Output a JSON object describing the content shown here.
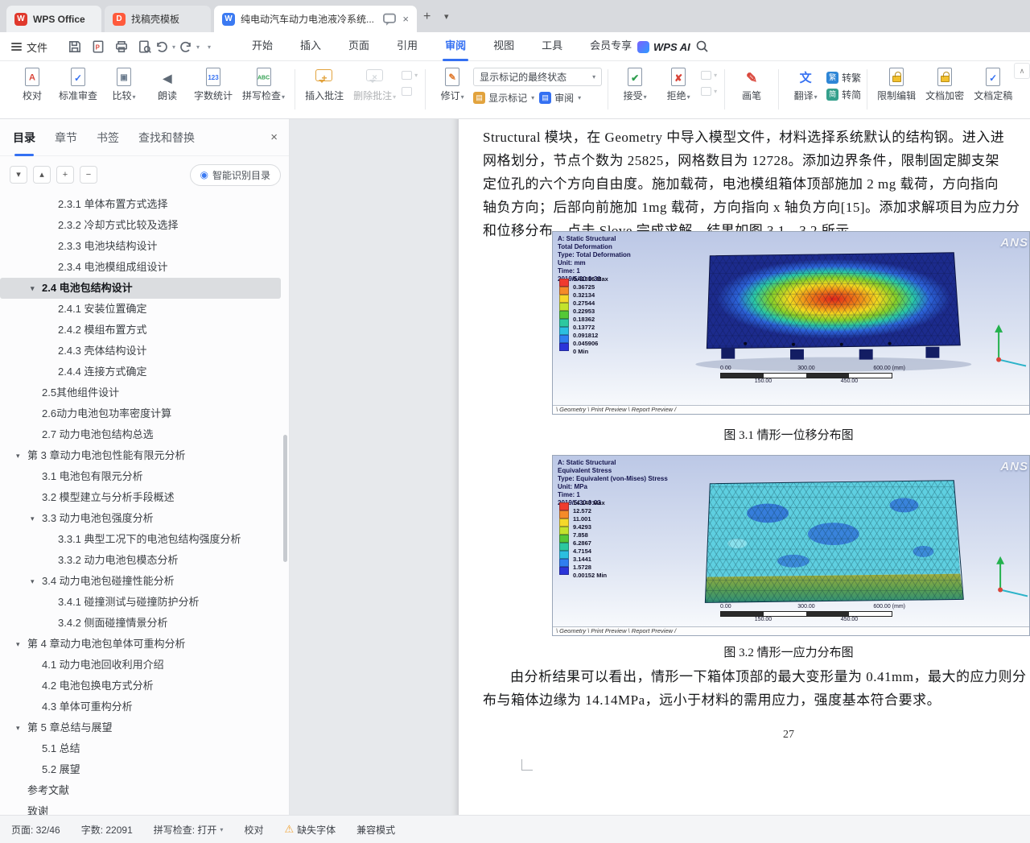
{
  "titlebar": {
    "home_tab": "WPS Office",
    "docer_tab": "找稿壳模板",
    "doc_tab": "纯电动汽车动力电池液冷系统..."
  },
  "menubar": {
    "file": "文件",
    "tabs": [
      "开始",
      "插入",
      "页面",
      "引用",
      "审阅",
      "视图",
      "工具",
      "会员专享"
    ],
    "active_tab_index": 4,
    "ai_label": "WPS AI"
  },
  "ribbon": {
    "markup_state": "显示标记的最终状态",
    "show_markup": "显示标记",
    "review": "审阅",
    "buttons": [
      {
        "g": 0,
        "name": "proofread",
        "icon": "proofread-icon",
        "label": "校对",
        "kind": "doc",
        "glyph": "A",
        "gc": "#d9453a",
        "gsize": "11px"
      },
      {
        "g": 0,
        "name": "standard-check",
        "icon": "standard-check-icon",
        "label": "标准审查",
        "kind": "doc",
        "glyph": "✓",
        "gc": "#3470f2",
        "gsize": "12px"
      },
      {
        "g": 0,
        "name": "compare",
        "icon": "compare-icon",
        "label": "比较",
        "kind": "doc",
        "glyph": "▣",
        "gc": "#6b7b8d",
        "gsize": "10px",
        "caret": true
      },
      {
        "g": 0,
        "name": "read-aloud",
        "icon": "read-aloud-icon",
        "label": "朗读",
        "kind": "plain",
        "glyph": "◀",
        "gc": "#5f6a76",
        "gsize": "14px"
      },
      {
        "g": 0,
        "name": "word-count",
        "icon": "word-count-icon",
        "label": "字数统计",
        "kind": "doc",
        "glyph": "123",
        "gc": "#3470f2",
        "gsize": "8px"
      },
      {
        "g": 0,
        "name": "spell-check",
        "icon": "spell-check-icon",
        "label": "拼写检查",
        "kind": "doc",
        "glyph": "ABC",
        "gc": "#2f9e4f",
        "gsize": "7px",
        "caret": true
      },
      {
        "g": 1,
        "name": "insert-comment",
        "icon": "insert-comment-icon",
        "label": "插入批注",
        "kind": "bubble",
        "bc": "bubble-orange",
        "glyph": "+",
        "gc": "#e2a33d",
        "gsize": "12px"
      },
      {
        "g": 1,
        "name": "delete-comment",
        "icon": "delete-comment-icon",
        "label": "删除批注",
        "kind": "bubble",
        "bc": "bubble-gray",
        "glyph": "×",
        "gc": "#9aa3ad",
        "gsize": "11px",
        "caret": true,
        "disabled": true
      },
      {
        "g": 2,
        "name": "track-changes",
        "icon": "track-changes-icon",
        "label": "修订",
        "kind": "doc",
        "glyph": "✎",
        "gc": "#e07a2e",
        "gsize": "11px",
        "caret": true
      },
      {
        "g": 3,
        "name": "accept",
        "icon": "accept-icon",
        "label": "接受",
        "kind": "doc",
        "glyph": "✔",
        "gc": "#2f9e4f",
        "gsize": "12px",
        "caret": true
      },
      {
        "g": 3,
        "name": "reject",
        "icon": "reject-icon",
        "label": "拒绝",
        "kind": "doc",
        "glyph": "✘",
        "gc": "#d9453a",
        "gsize": "12px",
        "caret": true
      },
      {
        "g": 4,
        "name": "ink-pen",
        "icon": "ink-pen-icon",
        "label": "画笔",
        "kind": "plain",
        "glyph": "✎",
        "gc": "#d9453a",
        "gsize": "17px"
      },
      {
        "g": 5,
        "name": "translate",
        "icon": "translate-icon",
        "label": "翻译",
        "kind": "plain",
        "glyph": "文",
        "gc": "#3470f2",
        "gsize": "15px",
        "caret": true
      },
      {
        "g": 6,
        "name": "restrict-edit",
        "icon": "restrict-edit-icon",
        "label": "限制编辑",
        "kind": "lock"
      },
      {
        "g": 6,
        "name": "encrypt",
        "icon": "encrypt-icon",
        "label": "文档加密",
        "kind": "lock"
      },
      {
        "g": 6,
        "name": "finalize",
        "icon": "finalize-icon",
        "label": "文档定稿",
        "kind": "doc",
        "glyph": "✓",
        "gc": "#3470f2",
        "gsize": "12px"
      }
    ],
    "conv": [
      {
        "name": "to-traditional",
        "glyph": "繁",
        "label": "转繁"
      },
      {
        "name": "to-simplified",
        "glyph": "简",
        "label": "转简"
      }
    ]
  },
  "sidebar": {
    "tabs": [
      "目录",
      "章节",
      "书签",
      "查找和替换"
    ],
    "active_tab_index": 0,
    "smart_toc": "智能识别目录",
    "items": [
      {
        "t": "2.3.1  单体布置方式选择",
        "l": 3
      },
      {
        "t": "2.3.2  冷却方式比较及选择",
        "l": 3
      },
      {
        "t": "2.3.3  电池块结构设计",
        "l": 3
      },
      {
        "t": "2.3.4  电池模组成组设计",
        "l": 3
      },
      {
        "t": "2.4 电池包结构设计",
        "l": 2,
        "c": true,
        "s": true
      },
      {
        "t": "2.4.1  安装位置确定",
        "l": 3
      },
      {
        "t": "2.4.2  模组布置方式",
        "l": 3
      },
      {
        "t": "2.4.3  壳体结构设计",
        "l": 3
      },
      {
        "t": "2.4.4  连接方式确定",
        "l": 3
      },
      {
        "t": "2.5其他组件设计",
        "l": 2
      },
      {
        "t": "2.6动力电池包功率密度计算",
        "l": 2
      },
      {
        "t": "2.7  动力电池包结构总选",
        "l": 2
      },
      {
        "t": "第 3 章动力电池包性能有限元分析",
        "l": 1,
        "c": true
      },
      {
        "t": "3.1  电池包有限元分析",
        "l": 2
      },
      {
        "t": "3.2  模型建立与分析手段概述",
        "l": 2
      },
      {
        "t": "3.3  动力电池包强度分析",
        "l": 2,
        "c": true
      },
      {
        "t": "3.3.1  典型工况下的电池包结构强度分析",
        "l": 3
      },
      {
        "t": "3.3.2  动力电池包模态分析",
        "l": 3
      },
      {
        "t": "3.4  动力电池包碰撞性能分析",
        "l": 2,
        "c": true
      },
      {
        "t": "3.4.1  碰撞测试与碰撞防护分析",
        "l": 3
      },
      {
        "t": "3.4.2 侧面碰撞情景分析",
        "l": 3
      },
      {
        "t": "第 4 章动力电池包单体可重构分析",
        "l": 1,
        "c": true
      },
      {
        "t": "4.1 动力电池回收利用介绍",
        "l": 2
      },
      {
        "t": "4.2  电池包换电方式分析",
        "l": 2
      },
      {
        "t": "4.3  单体可重构分析",
        "l": 2
      },
      {
        "t": "第 5 章总结与展望",
        "l": 1,
        "c": true
      },
      {
        "t": "5.1 总结",
        "l": 2
      },
      {
        "t": "5.2 展望",
        "l": 2
      },
      {
        "t": "参考文献",
        "l": 1
      },
      {
        "t": "致谢",
        "l": 1
      }
    ]
  },
  "document": {
    "para1_lines": [
      "Structural 模块，在 Geometry 中导入模型文件，材料选择系统默认的结构钢。进入进",
      "网格划分，节点个数为 25825，网格数目为 12728。添加边界条件，限制固定脚支架",
      "定位孔的六个方向自由度。施加载荷，电池模组箱体顶部施加 2 mg 载荷，方向指向",
      "轴负方向；后部向前施加 1mg 载荷，方向指向 x 轴负方向[15]。添加求解项目为应力分"
    ],
    "para1_tail": {
      "pre": "和位移分布。点击 ",
      "misspelled": "Slove",
      "post": " 完成求解，结果如图 3.1、3.2 所示。"
    },
    "caption1": "图 3.1 情形一位移分布图",
    "caption2": "图 3.2 情形一应力分布图",
    "para2_lines": [
      "由分析结果可以看出，情形一下箱体顶部的最大变形量为 0.41mm，最大的应力则分",
      "布与箱体边缘为 14.14MPa，远小于材料的需用应力，强度基本符合要求。"
    ],
    "page_number": "27",
    "fig1": {
      "header_lines": [
        "A: Static Structural",
        "Total Deformation",
        "Type: Total Deformation",
        "Unit: mm",
        "Time: 1",
        "2019/5/30 0:31"
      ],
      "legend_values": [
        "0.41316 Max",
        "0.36725",
        "0.32134",
        "0.27544",
        "0.22953",
        "0.18362",
        "0.13772",
        "0.091812",
        "0.045906",
        "0 Min"
      ],
      "legend_colors": [
        "#f03b2e",
        "#f58b28",
        "#f5d829",
        "#c3e32c",
        "#54c836",
        "#2cc8a0",
        "#2bbfe0",
        "#2f7ff0",
        "#2b35d9"
      ],
      "scale_top": [
        "0.00",
        "300.00",
        "600.00 (mm)"
      ],
      "scale_bottom": [
        "150.00",
        "450.00"
      ],
      "tabs": [
        "Geometry",
        "Print Preview",
        "Report Preview"
      ],
      "logo": "ANS"
    },
    "fig2": {
      "header_lines": [
        "A: Static Structural",
        "Equivalent Stress",
        "Type: Equivalent (von-Mises) Stress",
        "Unit: MPa",
        "Time: 1",
        "2019/5/30 0:03"
      ],
      "legend_values": [
        "14.143 Max",
        "12.572",
        "11.001",
        "9.4293",
        "7.858",
        "6.2867",
        "4.7154",
        "3.1441",
        "1.5728",
        "0.00152 Min"
      ],
      "legend_colors": [
        "#f03b2e",
        "#f58b28",
        "#f5d829",
        "#c3e32c",
        "#54c836",
        "#2cc8a0",
        "#2bbfe0",
        "#2f7ff0",
        "#2b35d9"
      ],
      "scale_top": [
        "0.00",
        "300.00",
        "600.00 (mm)"
      ],
      "scale_bottom": [
        "150.00",
        "450.00"
      ],
      "tabs": [
        "Geometry",
        "Print Preview",
        "Report Preview"
      ],
      "logo": "ANS"
    }
  },
  "statusbar": {
    "page": "页面: 32/46",
    "words": "字数: 22091",
    "spell": "拼写检查: 打开",
    "proofread": "校对",
    "missing_font": "缺失字体",
    "compat": "兼容模式"
  }
}
